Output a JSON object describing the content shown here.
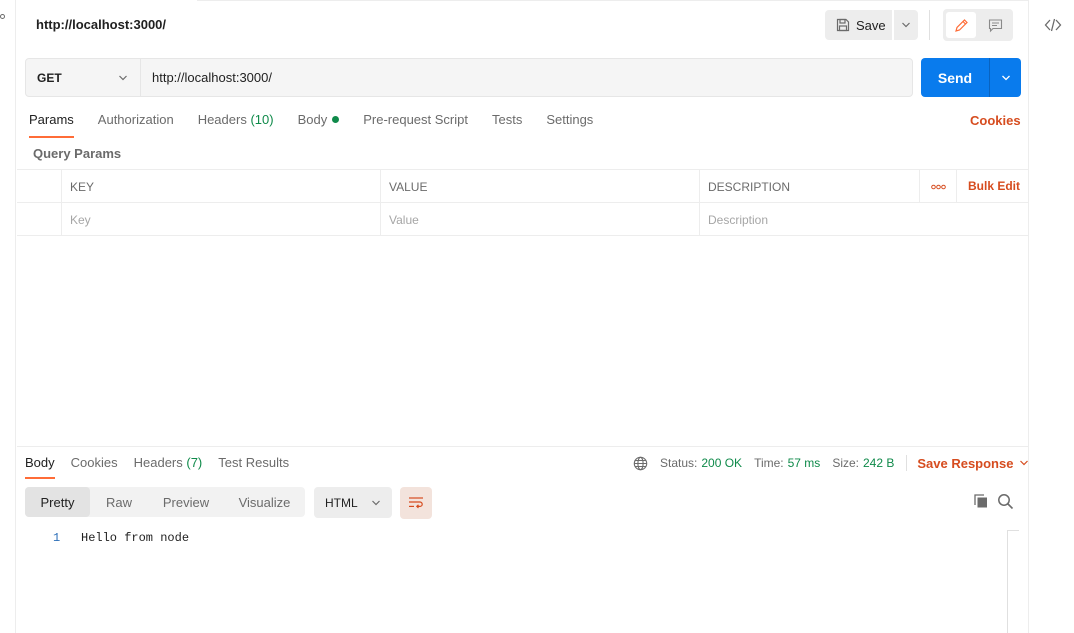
{
  "tab": {
    "title": "http://localhost:3000/"
  },
  "toolbar": {
    "save_label": "Save"
  },
  "request": {
    "method": "GET",
    "url": "http://localhost:3000/",
    "send_label": "Send",
    "tabs": [
      {
        "label": "Params",
        "active": true
      },
      {
        "label": "Authorization"
      },
      {
        "label": "Headers",
        "count": "(10)"
      },
      {
        "label": "Body",
        "dot": true
      },
      {
        "label": "Pre-request Script"
      },
      {
        "label": "Tests"
      },
      {
        "label": "Settings"
      }
    ],
    "cookies_label": "Cookies"
  },
  "params": {
    "section_label": "Query Params",
    "columns": [
      "KEY",
      "VALUE",
      "DESCRIPTION"
    ],
    "placeholders": {
      "key": "Key",
      "value": "Value",
      "description": "Description"
    },
    "bulk_edit_label": "Bulk Edit"
  },
  "response": {
    "tabs": [
      {
        "label": "Body",
        "active": true
      },
      {
        "label": "Cookies"
      },
      {
        "label": "Headers",
        "count": "(7)"
      },
      {
        "label": "Test Results"
      }
    ],
    "status_label": "Status:",
    "status_value": "200 OK",
    "time_label": "Time:",
    "time_value": "57 ms",
    "size_label": "Size:",
    "size_value": "242 B",
    "save_response_label": "Save Response",
    "view_modes": [
      "Pretty",
      "Raw",
      "Preview",
      "Visualize"
    ],
    "active_view": "Pretty",
    "language": "HTML",
    "body_lines": [
      {
        "num": "1",
        "text": "Hello from node"
      }
    ]
  },
  "colors": {
    "accent": "#ff6c37",
    "send_blue": "#097bed",
    "success_green": "#0f8a4a",
    "link_orange": "#d64c1f"
  },
  "icons": [
    "save-icon",
    "chevron-down-icon",
    "pencil-icon",
    "comment-icon",
    "code-icon",
    "more-icon",
    "globe-icon",
    "wrap-lines-icon",
    "copy-icon",
    "search-icon"
  ]
}
